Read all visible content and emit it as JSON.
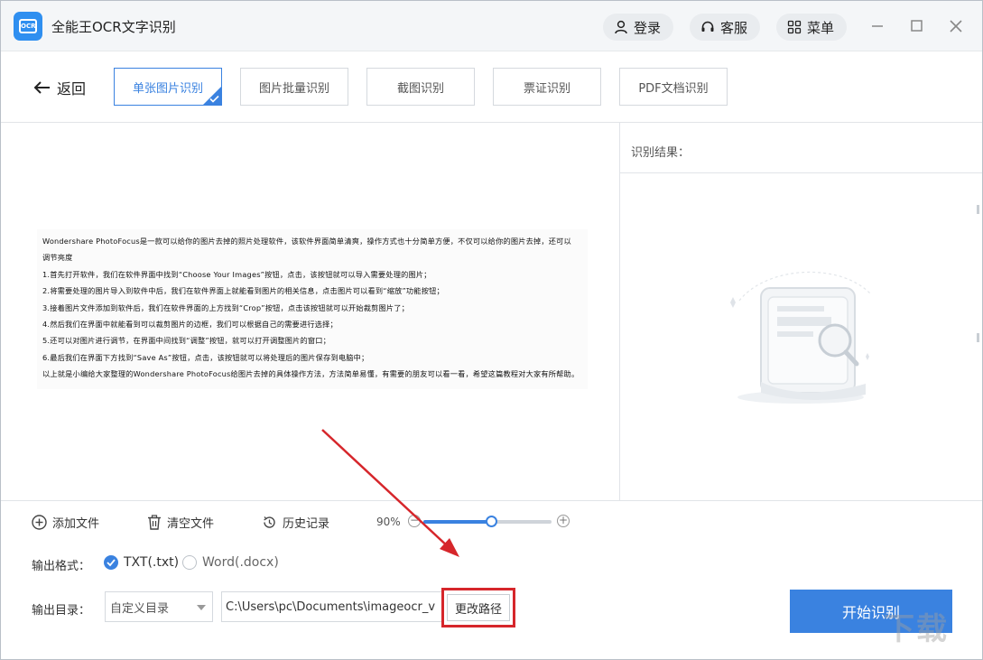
{
  "app": {
    "title": "全能王OCR文字识别",
    "logo_text": "OCR",
    "accent_color": "#3a82e0"
  },
  "titlebar": {
    "login_label": "登录",
    "support_label": "客服",
    "menu_label": "菜单"
  },
  "nav": {
    "back_label": "返回",
    "tabs": [
      {
        "label": "单张图片识别",
        "active": true
      },
      {
        "label": "图片批量识别",
        "active": false
      },
      {
        "label": "截图识别",
        "active": false
      },
      {
        "label": "票证识别",
        "active": false
      },
      {
        "label": "PDF文档识别",
        "active": false
      }
    ]
  },
  "preview": {
    "doc_lines": [
      "Wondershare PhotoFocus是一款可以给你的图片去掉的照片处理软件，该软件界面简单清爽，操作方式也十分简单方便，不仅可以给你的图片去掉，还可以",
      "调节亮度",
      "1.首先打开软件，我们在软件界面中找到“Choose Your Images”按钮，点击，该按钮就可以导入需要处理的图片；",
      "2.将需要处理的图片导入到软件中后，我们在软件界面上就能看到图片的相关信息，点击图片可以看到“缩放”功能按钮；",
      "3.接着图片文件添加到软件后，我们在软件界面的上方找到“Crop”按钮，点击该按钮就可以开始裁剪图片了；",
      "4.然后我们在界面中就能看到可以裁剪图片的边框，我们可以根据自己的需要进行选择；",
      "5.还可以对图片进行调节，在界面中间找到“调整”按钮，就可以打开调整图片的窗口；",
      "6.最后我们在界面下方找到“Save As”按钮，点击，该按钮就可以将处理后的图片保存到电脑中；",
      "以上就是小编给大家整理的Wondershare PhotoFocus给图片去掉的具体操作方法，方法简单易懂，有需要的朋友可以看一看，希望这篇教程对大家有所帮助。"
    ]
  },
  "result": {
    "label": "识别结果："
  },
  "toolbar": {
    "add_file_label": "添加文件",
    "clear_files_label": "清空文件",
    "history_label": "历史记录",
    "zoom_label": "90%",
    "zoom_fraction": 0.53
  },
  "output": {
    "format_label": "输出格式：",
    "format_options": [
      {
        "label": "TXT(.txt)",
        "checked": true
      },
      {
        "label": "Word(.docx)",
        "checked": false
      }
    ],
    "dir_label": "输出目录：",
    "dir_mode": "自定义目录",
    "dir_path": "C:\\Users\\pc\\Documents\\imageocr_v",
    "change_path_label": "更改路径",
    "start_label": "开始识别"
  },
  "watermark": "下载"
}
